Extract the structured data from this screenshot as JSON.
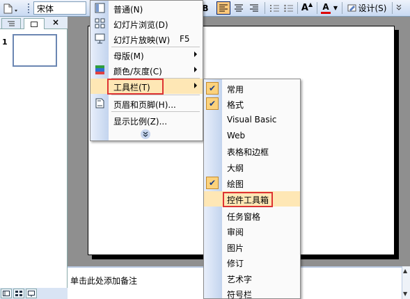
{
  "toolbar": {
    "font_name": "宋体",
    "bold_label": "B",
    "align_left": "≡",
    "align_center": "≡",
    "align_right": "≡",
    "font_grow_label": "A",
    "font_color_label": "A",
    "design_label": "设计(S)"
  },
  "left_pane": {
    "slide_number": "1"
  },
  "notes": {
    "placeholder": "单击此处添加备注"
  },
  "view_menu": {
    "items": [
      {
        "label": "普通(N)",
        "icon": "normal-view-icon"
      },
      {
        "label": "幻灯片浏览(D)",
        "icon": "slide-sorter-icon"
      },
      {
        "label": "幻灯片放映(W)",
        "shortcut": "F5",
        "icon": "slideshow-icon"
      },
      {
        "label": "母版(M)",
        "has_submenu": true
      },
      {
        "label": "颜色/灰度(C)",
        "has_submenu": true,
        "icon": "color-grayscale-icon"
      },
      {
        "label": "工具栏(T)",
        "has_submenu": true,
        "highlighted": true
      },
      {
        "label": "页眉和页脚(H)...",
        "icon": "header-footer-icon"
      },
      {
        "label": "显示比例(Z)..."
      }
    ],
    "expand_icon": "double-chevron-down-icon"
  },
  "toolbar_submenu": {
    "items": [
      {
        "label": "常用",
        "checked": true
      },
      {
        "label": "格式",
        "checked": true
      },
      {
        "label": "Visual Basic",
        "checked": false
      },
      {
        "label": "Web",
        "checked": false
      },
      {
        "label": "表格和边框",
        "checked": false
      },
      {
        "label": "大纲",
        "checked": false
      },
      {
        "label": "绘图",
        "checked": true
      },
      {
        "label": "控件工具箱",
        "checked": false,
        "highlighted": true
      },
      {
        "label": "任务窗格",
        "checked": false
      },
      {
        "label": "审阅",
        "checked": false
      },
      {
        "label": "图片",
        "checked": false
      },
      {
        "label": "修订",
        "checked": false
      },
      {
        "label": "艺术字",
        "checked": false
      },
      {
        "label": "符号栏",
        "checked": false
      }
    ]
  },
  "colors": {
    "highlight_border": "#d33333",
    "menu_hover": "#fee7b5",
    "check_bg": "#fcd27c"
  }
}
